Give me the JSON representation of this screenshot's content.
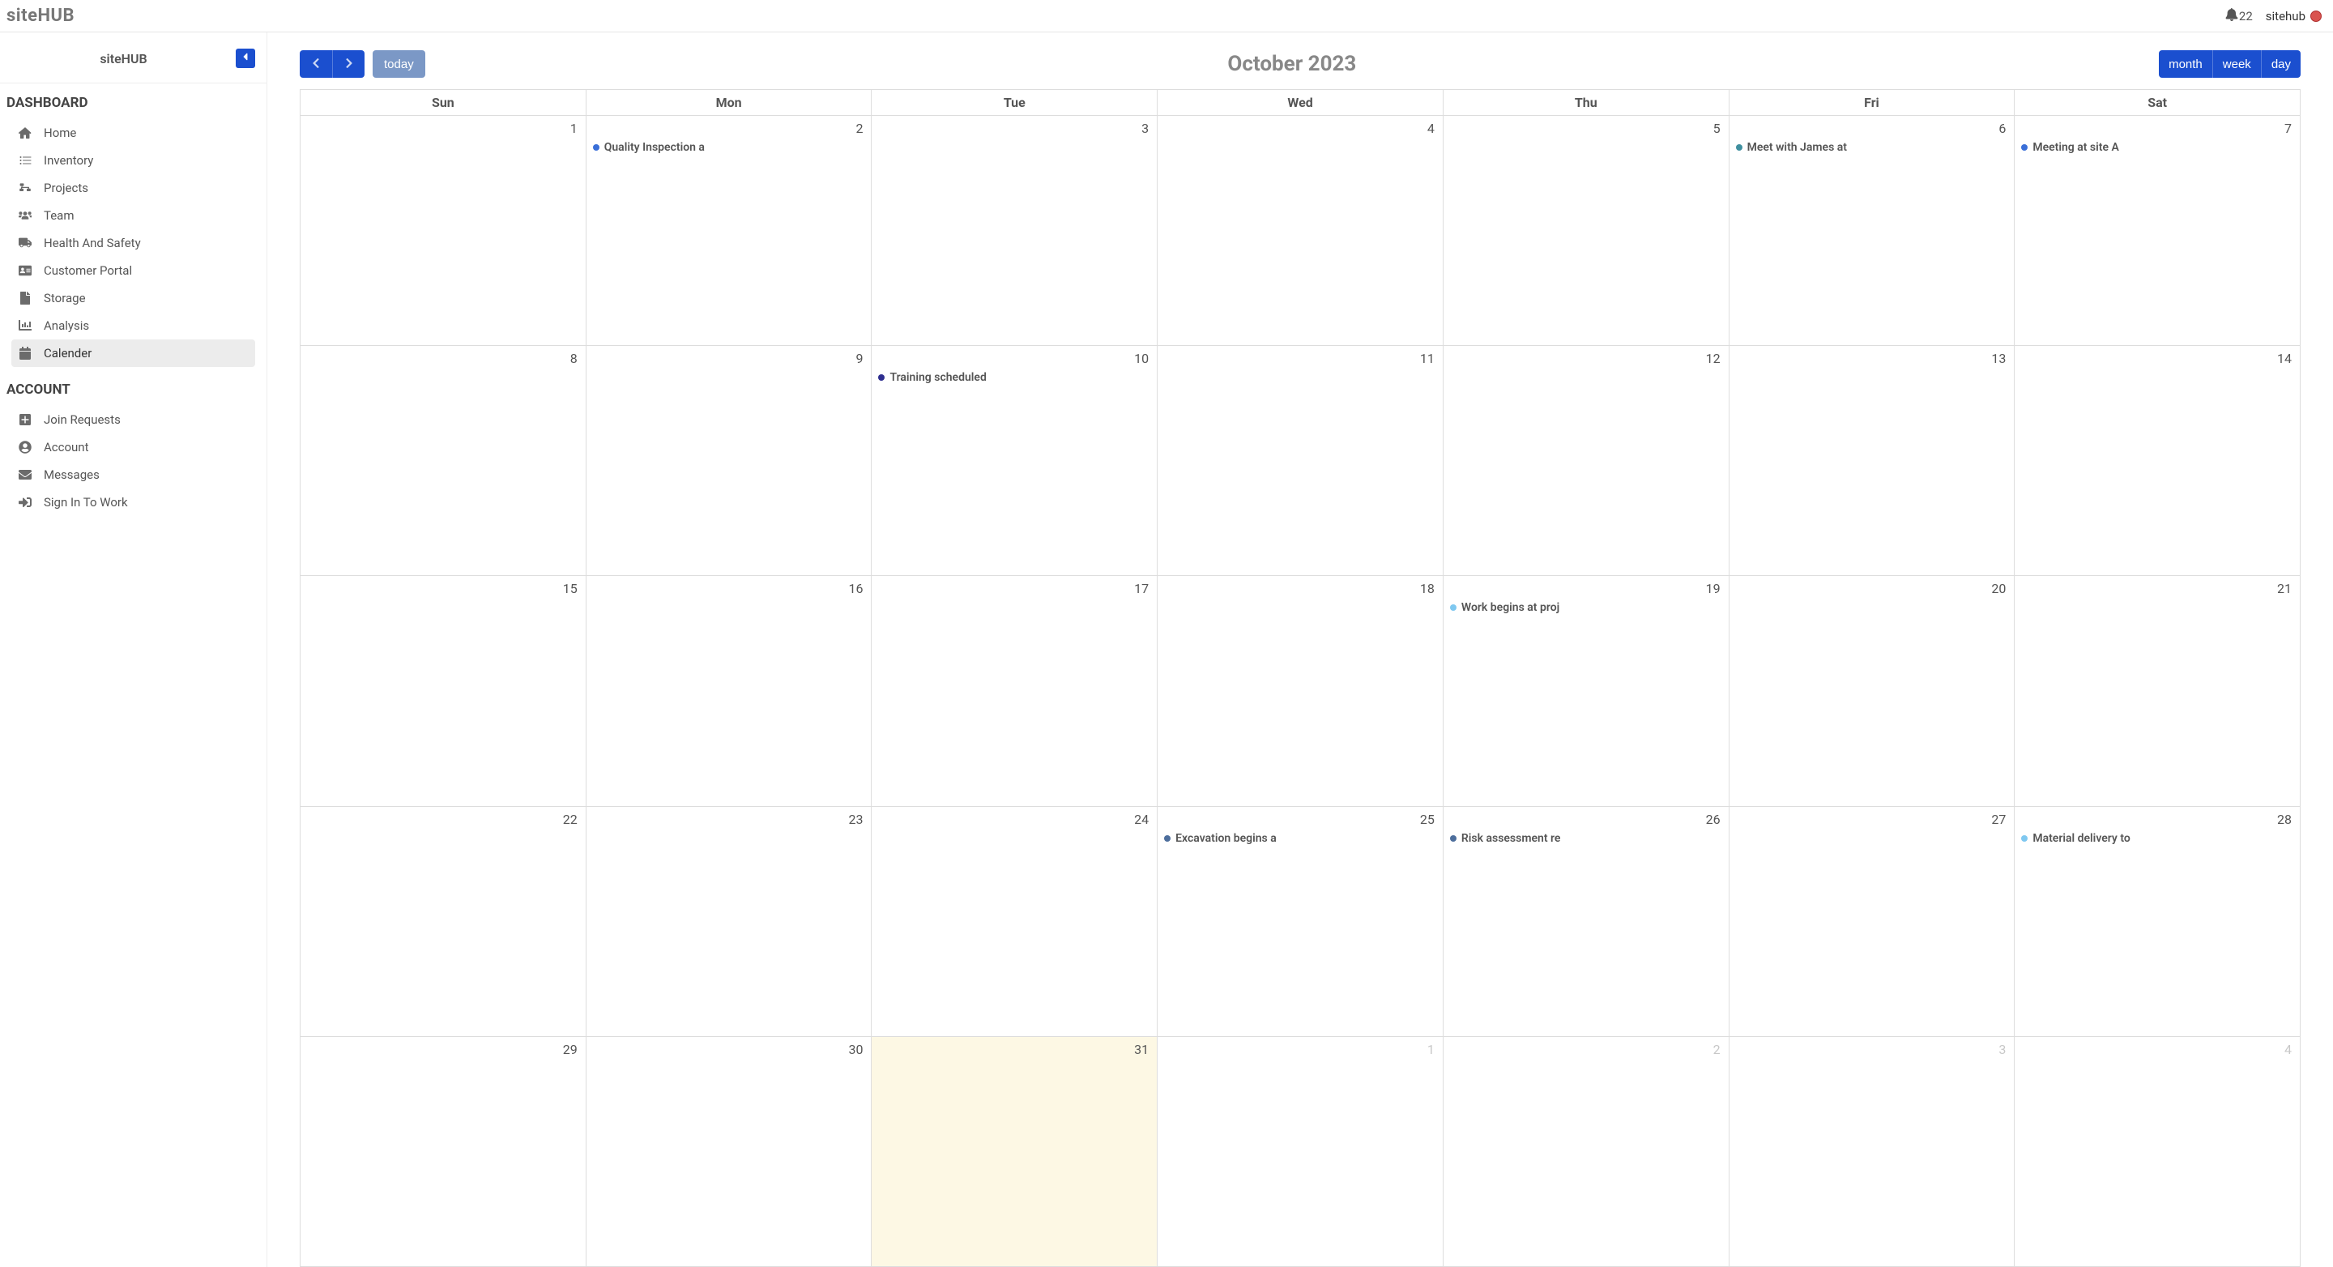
{
  "brand": "siteHUB",
  "topbar": {
    "notif_count": "22",
    "username": "sitehub"
  },
  "sidebar": {
    "title": "siteHUB",
    "sections": [
      {
        "title": "DASHBOARD",
        "items": [
          {
            "label": "Home",
            "icon": "home-icon",
            "active": false
          },
          {
            "label": "Inventory",
            "icon": "list-icon",
            "active": false
          },
          {
            "label": "Projects",
            "icon": "diagram-icon",
            "active": false
          },
          {
            "label": "Team",
            "icon": "users-icon",
            "active": false
          },
          {
            "label": "Health And Safety",
            "icon": "truck-icon",
            "active": false
          },
          {
            "label": "Customer Portal",
            "icon": "id-card-icon",
            "active": false
          },
          {
            "label": "Storage",
            "icon": "file-icon",
            "active": false
          },
          {
            "label": "Analysis",
            "icon": "bars-icon",
            "active": false
          },
          {
            "label": "Calender",
            "icon": "calendar-icon",
            "active": true
          }
        ]
      },
      {
        "title": "ACCOUNT",
        "items": [
          {
            "label": "Join Requests",
            "icon": "plus-square-icon",
            "active": false
          },
          {
            "label": "Account",
            "icon": "user-circle-icon",
            "active": false
          },
          {
            "label": "Messages",
            "icon": "envelope-icon",
            "active": false
          },
          {
            "label": "Sign In To Work",
            "icon": "signin-icon",
            "active": false
          }
        ]
      }
    ]
  },
  "calendar": {
    "title": "October 2023",
    "today_label": "today",
    "views": [
      "month",
      "week",
      "day"
    ],
    "dow": [
      "Sun",
      "Mon",
      "Tue",
      "Wed",
      "Thu",
      "Fri",
      "Sat"
    ],
    "event_colors": {
      "blue": "#3a6fd8",
      "teal": "#3f8f9f",
      "navy": "#2e2e8f",
      "sky": "#7fc8f0",
      "steel": "#4d6e9c"
    },
    "weeks": [
      [
        {
          "n": "1"
        },
        {
          "n": "2",
          "events": [
            {
              "label": "Quality Inspection a",
              "color": "blue"
            }
          ]
        },
        {
          "n": "3"
        },
        {
          "n": "4"
        },
        {
          "n": "5"
        },
        {
          "n": "6",
          "events": [
            {
              "label": "Meet with James at",
              "color": "teal"
            }
          ]
        },
        {
          "n": "7",
          "events": [
            {
              "label": "Meeting at site A",
              "color": "blue"
            }
          ]
        }
      ],
      [
        {
          "n": "8"
        },
        {
          "n": "9"
        },
        {
          "n": "10",
          "events": [
            {
              "label": "Training scheduled",
              "color": "navy"
            }
          ]
        },
        {
          "n": "11"
        },
        {
          "n": "12"
        },
        {
          "n": "13"
        },
        {
          "n": "14"
        }
      ],
      [
        {
          "n": "15"
        },
        {
          "n": "16"
        },
        {
          "n": "17"
        },
        {
          "n": "18"
        },
        {
          "n": "19",
          "events": [
            {
              "label": "Work begins at proj",
              "color": "sky"
            }
          ]
        },
        {
          "n": "20"
        },
        {
          "n": "21"
        }
      ],
      [
        {
          "n": "22"
        },
        {
          "n": "23"
        },
        {
          "n": "24"
        },
        {
          "n": "25",
          "events": [
            {
              "label": "Excavation begins a",
              "color": "steel"
            }
          ]
        },
        {
          "n": "26",
          "events": [
            {
              "label": "Risk assessment re",
              "color": "steel"
            }
          ]
        },
        {
          "n": "27"
        },
        {
          "n": "28",
          "events": [
            {
              "label": "Material delivery to",
              "color": "sky"
            }
          ]
        }
      ],
      [
        {
          "n": "29"
        },
        {
          "n": "30"
        },
        {
          "n": "31",
          "today": true
        },
        {
          "n": "1",
          "other": true
        },
        {
          "n": "2",
          "other": true
        },
        {
          "n": "3",
          "other": true
        },
        {
          "n": "4",
          "other": true
        }
      ]
    ]
  }
}
